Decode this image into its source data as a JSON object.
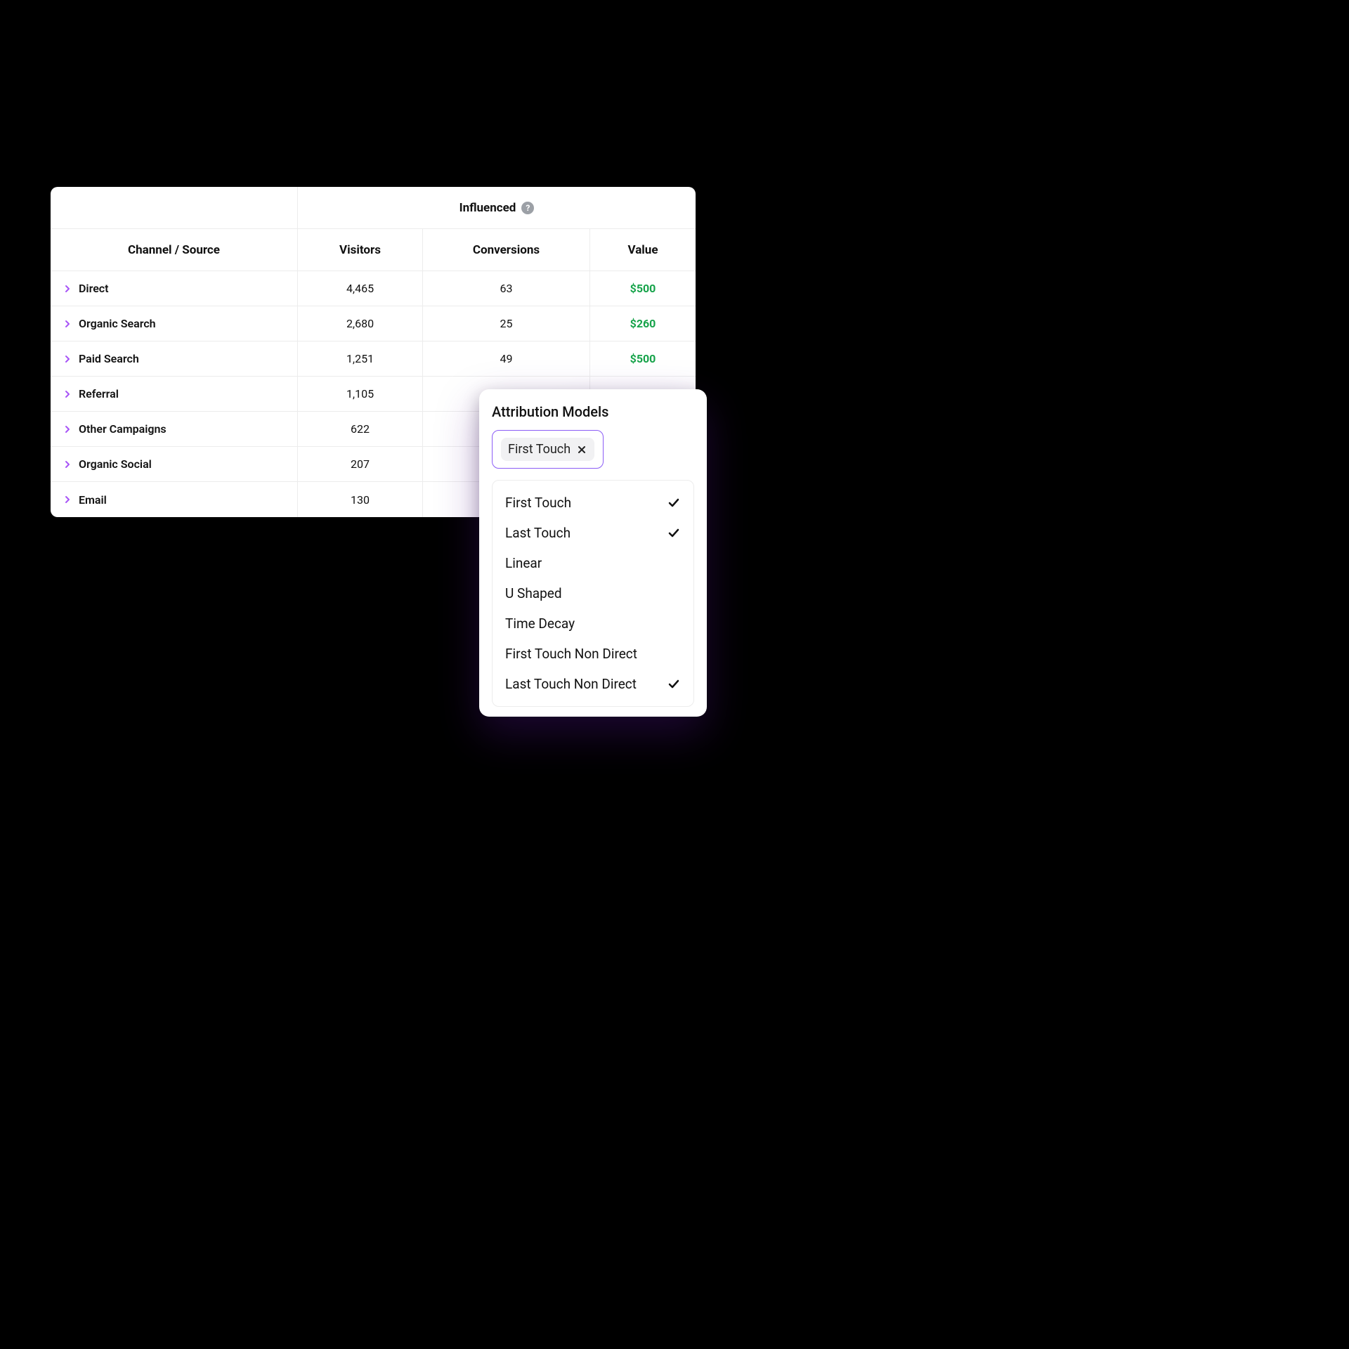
{
  "table": {
    "group_header": "Influenced",
    "columns": {
      "channel": "Channel / Source",
      "visitors": "Visitors",
      "conversions": "Conversions",
      "value": "Value"
    },
    "rows": [
      {
        "channel": "Direct",
        "visitors": "4,465",
        "conversions": "63",
        "value": "$500"
      },
      {
        "channel": "Organic Search",
        "visitors": "2,680",
        "conversions": "25",
        "value": "$260"
      },
      {
        "channel": "Paid Search",
        "visitors": "1,251",
        "conversions": "49",
        "value": "$500"
      },
      {
        "channel": "Referral",
        "visitors": "1,105",
        "conversions": "",
        "value": ""
      },
      {
        "channel": "Other Campaigns",
        "visitors": "622",
        "conversions": "",
        "value": ""
      },
      {
        "channel": "Organic Social",
        "visitors": "207",
        "conversions": "",
        "value": ""
      },
      {
        "channel": "Email",
        "visitors": "130",
        "conversions": "",
        "value": ""
      }
    ]
  },
  "dropdown": {
    "title": "Attribution Models",
    "selected_chip": "First Touch",
    "options": [
      {
        "label": "First Touch",
        "checked": true
      },
      {
        "label": "Last Touch",
        "checked": true
      },
      {
        "label": "Linear",
        "checked": false
      },
      {
        "label": "U Shaped",
        "checked": false
      },
      {
        "label": "Time Decay",
        "checked": false
      },
      {
        "label": "First Touch Non Direct",
        "checked": false
      },
      {
        "label": "Last Touch Non Direct",
        "checked": true
      }
    ]
  },
  "colors": {
    "accent_purple": "#8b5cf6",
    "value_green": "#16a34a"
  }
}
